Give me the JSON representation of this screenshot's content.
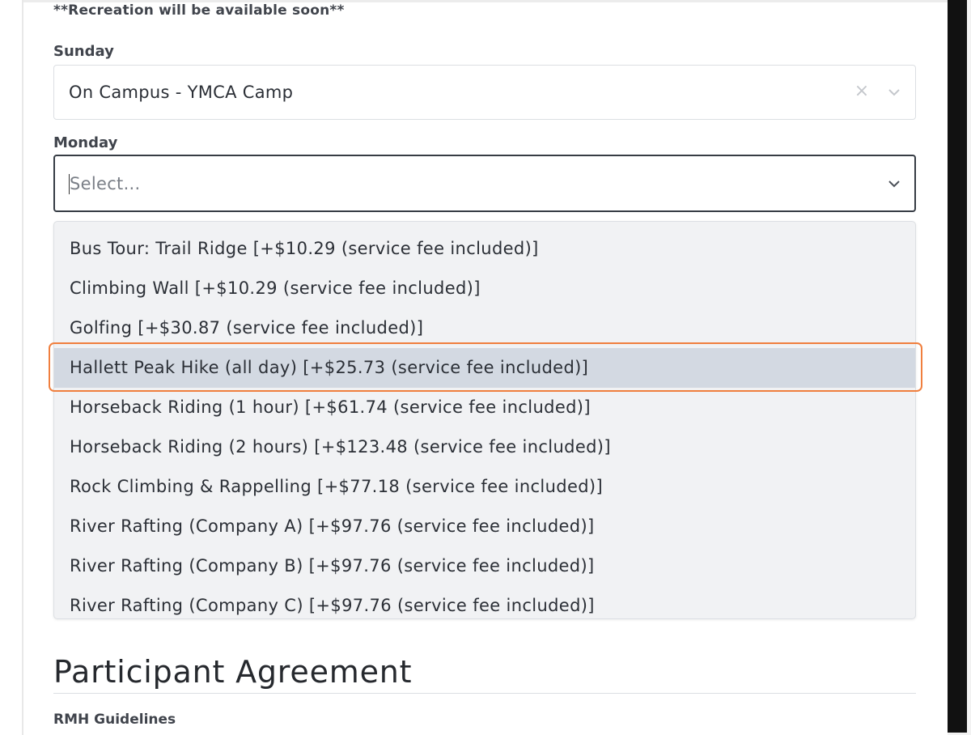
{
  "notice": "**Recreation will be available soon**",
  "sunday": {
    "label": "Sunday",
    "value": "On Campus - YMCA Camp"
  },
  "monday": {
    "label": "Monday",
    "placeholder": "Select..."
  },
  "icons": {
    "clear": "close-icon",
    "dropdown": "chevron-down-icon"
  },
  "menu": {
    "options": [
      "Bus Tour: Trail Ridge [+$10.29 (service fee included)]",
      "Climbing Wall [+$10.29 (service fee included)]",
      "Golfing [+$30.87 (service fee included)]",
      "Hallett Peak Hike (all day) [+$25.73 (service fee included)]",
      "Horseback Riding (1 hour) [+$61.74 (service fee included)]",
      "Horseback Riding (2 hours) [+$123.48 (service fee included)]",
      "Rock Climbing & Rappelling [+$77.18 (service fee included)]",
      "River Rafting (Company A) [+$97.76 (service fee included)]",
      "River Rafting (Company B) [+$97.76 (service fee included)]",
      "River Rafting (Company C) [+$97.76 (service fee included)]"
    ],
    "highlighted_option": "Hallett Peak Hike (all day) [+$25.73 (service fee included)]"
  },
  "section": {
    "title": "Participant Agreement",
    "sub_label": "RMH Guidelines"
  },
  "colors": {
    "highlight_bg": "#d3d9e2",
    "annotation_ring": "#f07f3e"
  }
}
